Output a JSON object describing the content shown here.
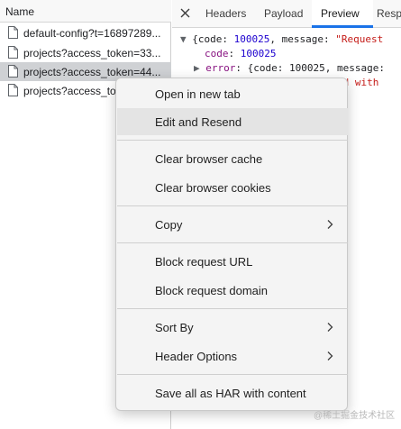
{
  "network": {
    "column_header": "Name",
    "requests": [
      {
        "name": "default-config?t=16897289..."
      },
      {
        "name": "projects?access_token=33..."
      },
      {
        "name": "projects?access_token=44..."
      },
      {
        "name": "projects?access_to"
      }
    ]
  },
  "details": {
    "tabs": [
      "Headers",
      "Payload",
      "Preview",
      "Resp"
    ],
    "active_tab": "Preview",
    "preview": {
      "line1": {
        "open": "{code: ",
        "code_val": "100025",
        "mid": ", message: ",
        "msg": "\"Request"
      },
      "line2": {
        "key": "code",
        "sep": ": ",
        "val": "100025"
      },
      "line3": {
        "key": "error",
        "rest": ": {code: 100025, message: "
      },
      "line4": {
        "str": "ed with"
      }
    }
  },
  "context_menu": {
    "items": [
      {
        "label": "Open in new tab"
      },
      {
        "label": "Edit and Resend"
      },
      {
        "label": "Clear browser cache"
      },
      {
        "label": "Clear browser cookies"
      },
      {
        "label": "Copy"
      },
      {
        "label": "Block request URL"
      },
      {
        "label": "Block request domain"
      },
      {
        "label": "Sort By"
      },
      {
        "label": "Header Options"
      },
      {
        "label": "Save all as HAR with content"
      }
    ]
  },
  "watermark": "@稀土掘金技术社区",
  "colors": {
    "selected_row": "#cfd1d4",
    "active_tab_underline": "#1a73e8",
    "menu_hover": "#e4e4e4",
    "json_key": "#881280",
    "json_number": "#1c00cf",
    "json_string": "#c41a16"
  }
}
